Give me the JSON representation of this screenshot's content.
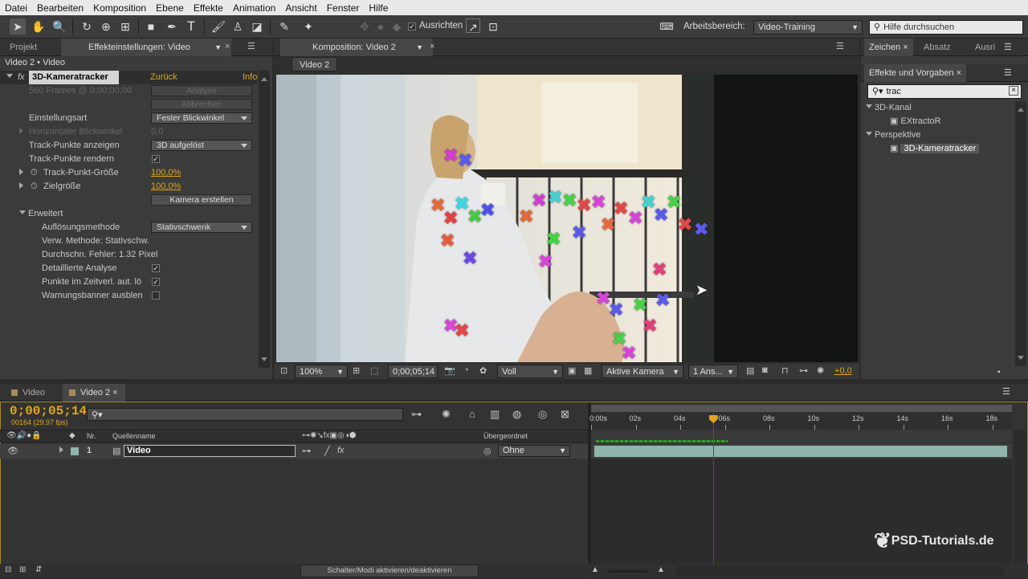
{
  "menu": [
    "Datei",
    "Bearbeiten",
    "Komposition",
    "Ebene",
    "Effekte",
    "Animation",
    "Ansicht",
    "Fenster",
    "Hilfe"
  ],
  "toolbar": {
    "align_label": "Ausrichten",
    "workspace_label": "Arbeitsbereich:",
    "workspace_value": "Video-Training",
    "help_placeholder": "Hilfe durchsuchen"
  },
  "effects_panel": {
    "tab_project": "Projekt",
    "tab_effects": "Effekteinstellungen: Video",
    "breadcrumb": "Video 2 • Video",
    "effect_name": "3D-Kameratracker",
    "reset": "Zurück",
    "info": "Info",
    "frames_info": "560 Frames @ 0;00;00;00",
    "analyse": "Analyse",
    "cancel": "Abbrechen",
    "settings_label": "Einstellungsart",
    "settings_value": "Fester Blickwinkel",
    "hfov_label": "Horizontaler Blickwinkel",
    "hfov_value": "0,0",
    "show_points_label": "Track-Punkte anzeigen",
    "show_points_value": "3D aufgelöst",
    "render_points_label": "Track-Punkte rendern",
    "point_size_label": "Track-Punkt-Größe",
    "point_size_value": "100,0%",
    "target_size_label": "Zielgröße",
    "target_size_value": "100,0%",
    "create_camera": "Kamera erstellen",
    "advanced": "Erweitert",
    "solve_method_label": "Auflösungsmethode",
    "solve_method_value": "Stativschwenk",
    "used_method": "Verw. Methode: Stativschw.",
    "avg_error": "Durchschn. Fehler: 1.32 Pixel",
    "detailed_label": "Detaillierte Analyse",
    "auto_delete_label": "Punkte im Zeitverl. aut. lö",
    "hide_warning_label": "Warnungsbanner ausblen"
  },
  "comp_panel": {
    "tab": "Komposition: Video 2",
    "sub_tab": "Video 2",
    "zoom": "100%",
    "timecode": "0;00;05;14",
    "resolution": "Voll",
    "camera": "Aktive Kamera",
    "views": "1 Ans...",
    "exposure": "+0,0"
  },
  "right_panel": {
    "tab1": "Zeichen",
    "tab2": "Absatz",
    "tab3": "Ausri",
    "effects_tab": "Effekte und Vorgaben",
    "search_value": "trac",
    "cat1": "3D-Kanal",
    "item1": "EXtractoR",
    "cat2": "Perspektive",
    "item2": "3D-Kameratracker"
  },
  "timeline": {
    "tab1": "Video",
    "tab2": "Video 2",
    "timecode": "0;00;05;14",
    "frame_info": "00164 (29.97 fps)",
    "col_nr": "Nr.",
    "col_source": "Quellenname",
    "col_parent": "Übergeordnet",
    "layer_nr": "1",
    "layer_name": "Video",
    "parent_value": "Ohne",
    "toggle_label": "Schalter/Modi aktivieren/deaktivieren",
    "ruler": [
      "0:00s",
      "02s",
      "04s",
      "06s",
      "08s",
      "10s",
      "12s",
      "14s",
      "16s",
      "18s"
    ],
    "playhead_seconds": 5.47
  },
  "watermark": "PSD-Tutorials.de",
  "colors": {
    "accent": "#e3a51a",
    "playhead": "#d11a1a",
    "layer_bar": "#8fb5ad"
  }
}
